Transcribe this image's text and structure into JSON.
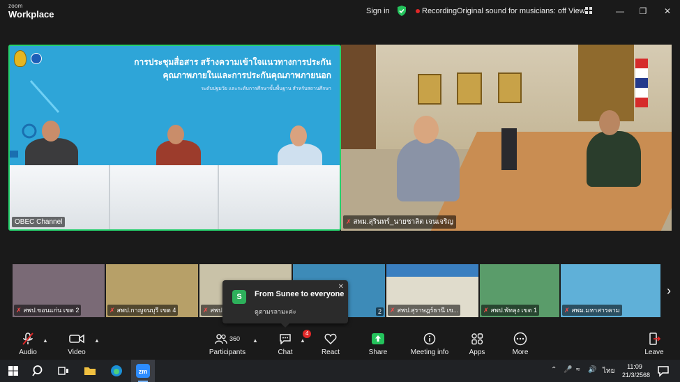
{
  "titlebar": {
    "logo_line1": "zoom",
    "logo_line2": "Workplace",
    "sign_in": "Sign in",
    "recording": "Recording",
    "original_sound": "Original sound for musicians: off",
    "view": "View"
  },
  "main_tiles": {
    "left": {
      "name": "OBEC Channel",
      "title_line1": "การประชุมสื่อสาร สร้างความเข้าใจแนวทางการประกัน",
      "title_line2": "คุณภาพภายในและการประกันคุณภาพภายนอก",
      "subtitle": "ระดับปฐมวัย และระดับการศึกษาขั้นพื้นฐาน สำหรับสถานศึกษา"
    },
    "right": {
      "name": "สพม.สุรินทร์_นายชาลิต เจนเจริญ"
    }
  },
  "thumbnails": [
    {
      "name": "สพป.ขอนแก่น เขต 2"
    },
    {
      "name": "สพป.กาญจนบุรี เขต 4"
    },
    {
      "name": "สพป..."
    },
    {
      "name": "2"
    },
    {
      "name": "สพป.สุราษฎร์ธานี เข..."
    },
    {
      "name": "สพป.พัทลุง เขต 1"
    },
    {
      "name": "สพม.มหาสารคาม"
    }
  ],
  "chat_popup": {
    "avatar_letter": "S",
    "from": "From Sunee to everyone",
    "message": "ดูตามรลามะค่ะ"
  },
  "toolbar": {
    "audio": "Audio",
    "video": "Video",
    "participants": "Participants",
    "participants_count": "360",
    "chat": "Chat",
    "chat_badge": "4",
    "react": "React",
    "share": "Share",
    "meeting_info": "Meeting info",
    "apps": "Apps",
    "more": "More",
    "leave": "Leave"
  },
  "taskbar": {
    "lang": "ไทย",
    "time": "11:09",
    "date": "21/3/2568"
  },
  "colors": {
    "active_speaker_border": "#24d06b",
    "recording_dot": "#e02828",
    "share_green": "#24c35c",
    "leave_red": "#e02828"
  }
}
